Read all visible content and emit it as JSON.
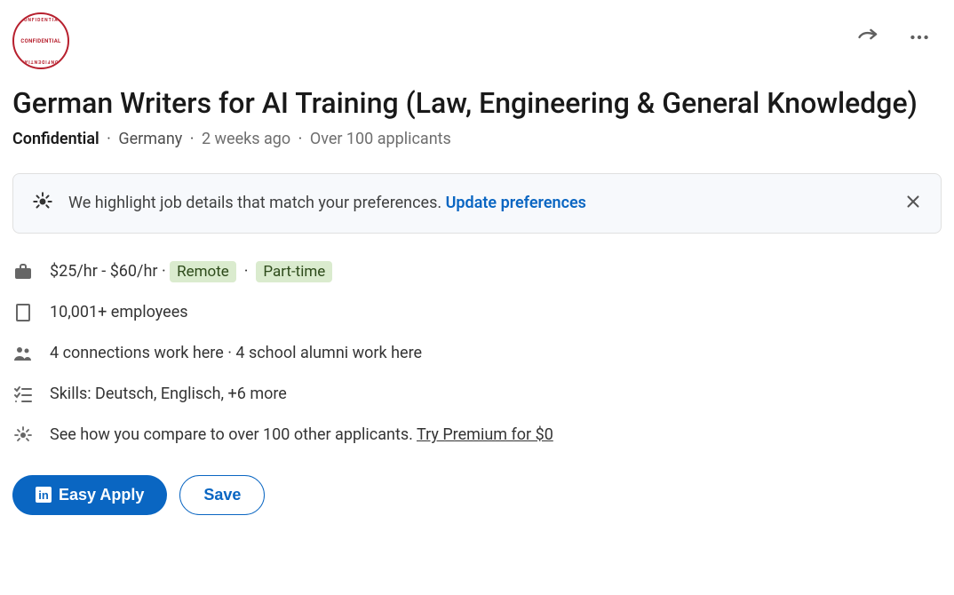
{
  "logo": {
    "center": "CONFIDENTIAL",
    "ring": "CONFIDENTIAL"
  },
  "job": {
    "title": "German Writers for AI Training (Law, Engineering & General Knowledge)",
    "company": "Confidential",
    "location": "Germany",
    "posted_ago": "2 weeks ago",
    "applicants": "Over 100 applicants"
  },
  "banner": {
    "text": "We highlight job details that match your preferences.",
    "link": "Update preferences"
  },
  "details": {
    "pay_text": "$25/hr - $60/hr",
    "remote_pill": "Remote",
    "type_pill": "Part-time",
    "employees": "10,001+ employees",
    "network": "4 connections work here · 4 school alumni work here",
    "skills": "Skills: Deutsch, Englisch, +6 more",
    "compare_text": "See how you compare to over 100 other applicants. ",
    "premium_link": "Try Premium for $0"
  },
  "actions": {
    "apply": "Easy Apply",
    "save": "Save"
  },
  "sep": " · "
}
